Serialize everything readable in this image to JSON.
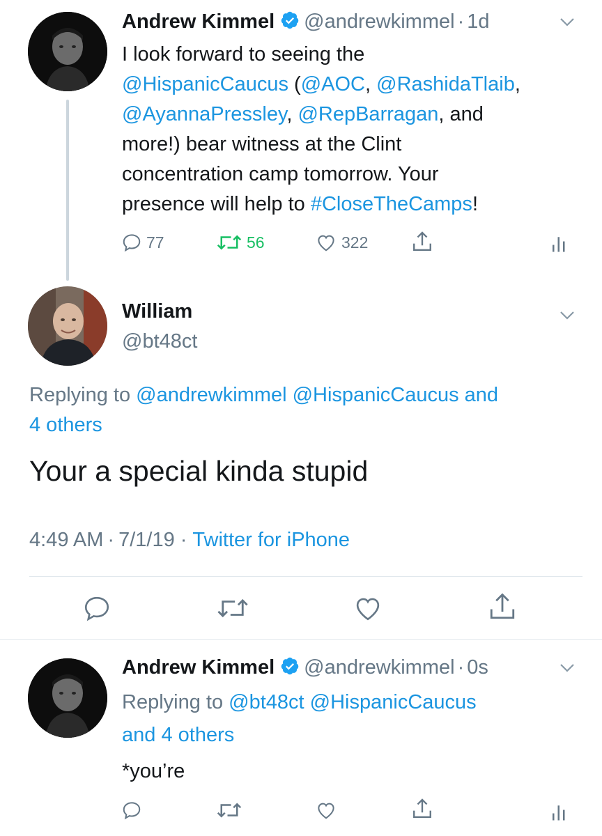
{
  "tweet1": {
    "name": "Andrew Kimmel",
    "handle": "@andrewkimmel",
    "sep": "·",
    "time": "1d",
    "lines": [
      [
        {
          "t": "I look forward to seeing the",
          "link": false
        }
      ],
      [
        {
          "t": "@HispanicCaucus",
          "link": true
        },
        {
          "t": " (",
          "link": false
        },
        {
          "t": "@AOC",
          "link": true
        },
        {
          "t": ", ",
          "link": false
        },
        {
          "t": "@RashidaTlaib",
          "link": true
        },
        {
          "t": ",",
          "link": false
        }
      ],
      [
        {
          "t": "@AyannaPressley",
          "link": true
        },
        {
          "t": ", ",
          "link": false
        },
        {
          "t": "@RepBarragan",
          "link": true
        },
        {
          "t": ", and",
          "link": false
        }
      ],
      [
        {
          "t": "more!) bear witness at the Clint",
          "link": false
        }
      ],
      [
        {
          "t": "concentration camp tomorrow. Your",
          "link": false
        }
      ],
      [
        {
          "t": "presence will help to ",
          "link": false
        },
        {
          "t": "#CloseTheCamps",
          "link": true
        },
        {
          "t": "!",
          "link": false
        }
      ]
    ],
    "replies": "77",
    "retweets": "56",
    "likes": "322"
  },
  "tweet2": {
    "name": "William",
    "handle": "@bt48ct",
    "replying_prefix": "Replying to ",
    "replying_line1_links": [
      "@andrewkimmel",
      "@HispanicCaucus"
    ],
    "replying_line1_suffix": " and",
    "replying_line2": "4 others",
    "text": "Your a special kinda stupid",
    "time": "4:49 AM",
    "sep1": "·",
    "date": "7/1/19",
    "sep2": "·",
    "source": "Twitter for iPhone"
  },
  "tweet3": {
    "name": "Andrew Kimmel",
    "handle": "@andrewkimmel",
    "sep": "·",
    "time": "0s",
    "replying_prefix": "Replying to ",
    "replying_links": [
      "@bt48ct",
      "@HispanicCaucus"
    ],
    "replying_line2": "and 4 others",
    "text": "*you’re"
  },
  "colors": {
    "link": "#1b95e0",
    "secondary": "#657786",
    "retweet_active": "#17bf63",
    "divider": "#e1e8ed",
    "verified": "#1da1f2"
  },
  "icons": [
    "verified-badge-icon",
    "chevron-down-icon",
    "reply-icon",
    "retweet-icon",
    "like-icon",
    "share-icon",
    "analytics-icon"
  ]
}
